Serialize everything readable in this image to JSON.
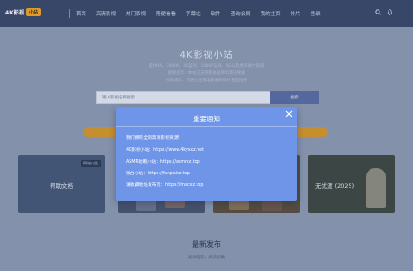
{
  "header": {
    "logo_text": "4K影视",
    "logo_badge": "小站",
    "nav": [
      "首页",
      "高清影视",
      "热门影视",
      "随便看看",
      "字幕站",
      "软件",
      "查询会员",
      "我的主页",
      "排片",
      "登录"
    ]
  },
  "hero": {
    "title": "4K影视小站",
    "line1": "提供4K、1080P、4K蓝光、1080P蓝光、4G以及更多磁力链接",
    "line2": "搜索提示：本站已支持影视名称和演员搜索",
    "line3": "搜索提示：可通过豆瓣电影编码或片名直接搜",
    "search_placeholder": "输入影视名称搜索...",
    "search_button": "搜索"
  },
  "cards": [
    {
      "label": "帮助文档",
      "tag": "网站公告"
    },
    {
      "label": "无忧渡 (2025)",
      "tag": ""
    }
  ],
  "section": {
    "title": "最新发布",
    "subtitle": "高清电影、高清剧集"
  },
  "modal": {
    "title": "重要通知",
    "lines": [
      "我们拥有全网高清影视资源!",
      "4K影视小站：https://www.4kysxz.net",
      "ASMR助眠小站：https://asmrxz.top",
      "饭台小站：https://fanpaixz.top",
      "请收藏地址发布页：https://macxz.top"
    ]
  },
  "colors": {
    "header_bg": "#3a4a6a",
    "modal_bg": "#6f95e8",
    "accent": "#d79a2c"
  }
}
